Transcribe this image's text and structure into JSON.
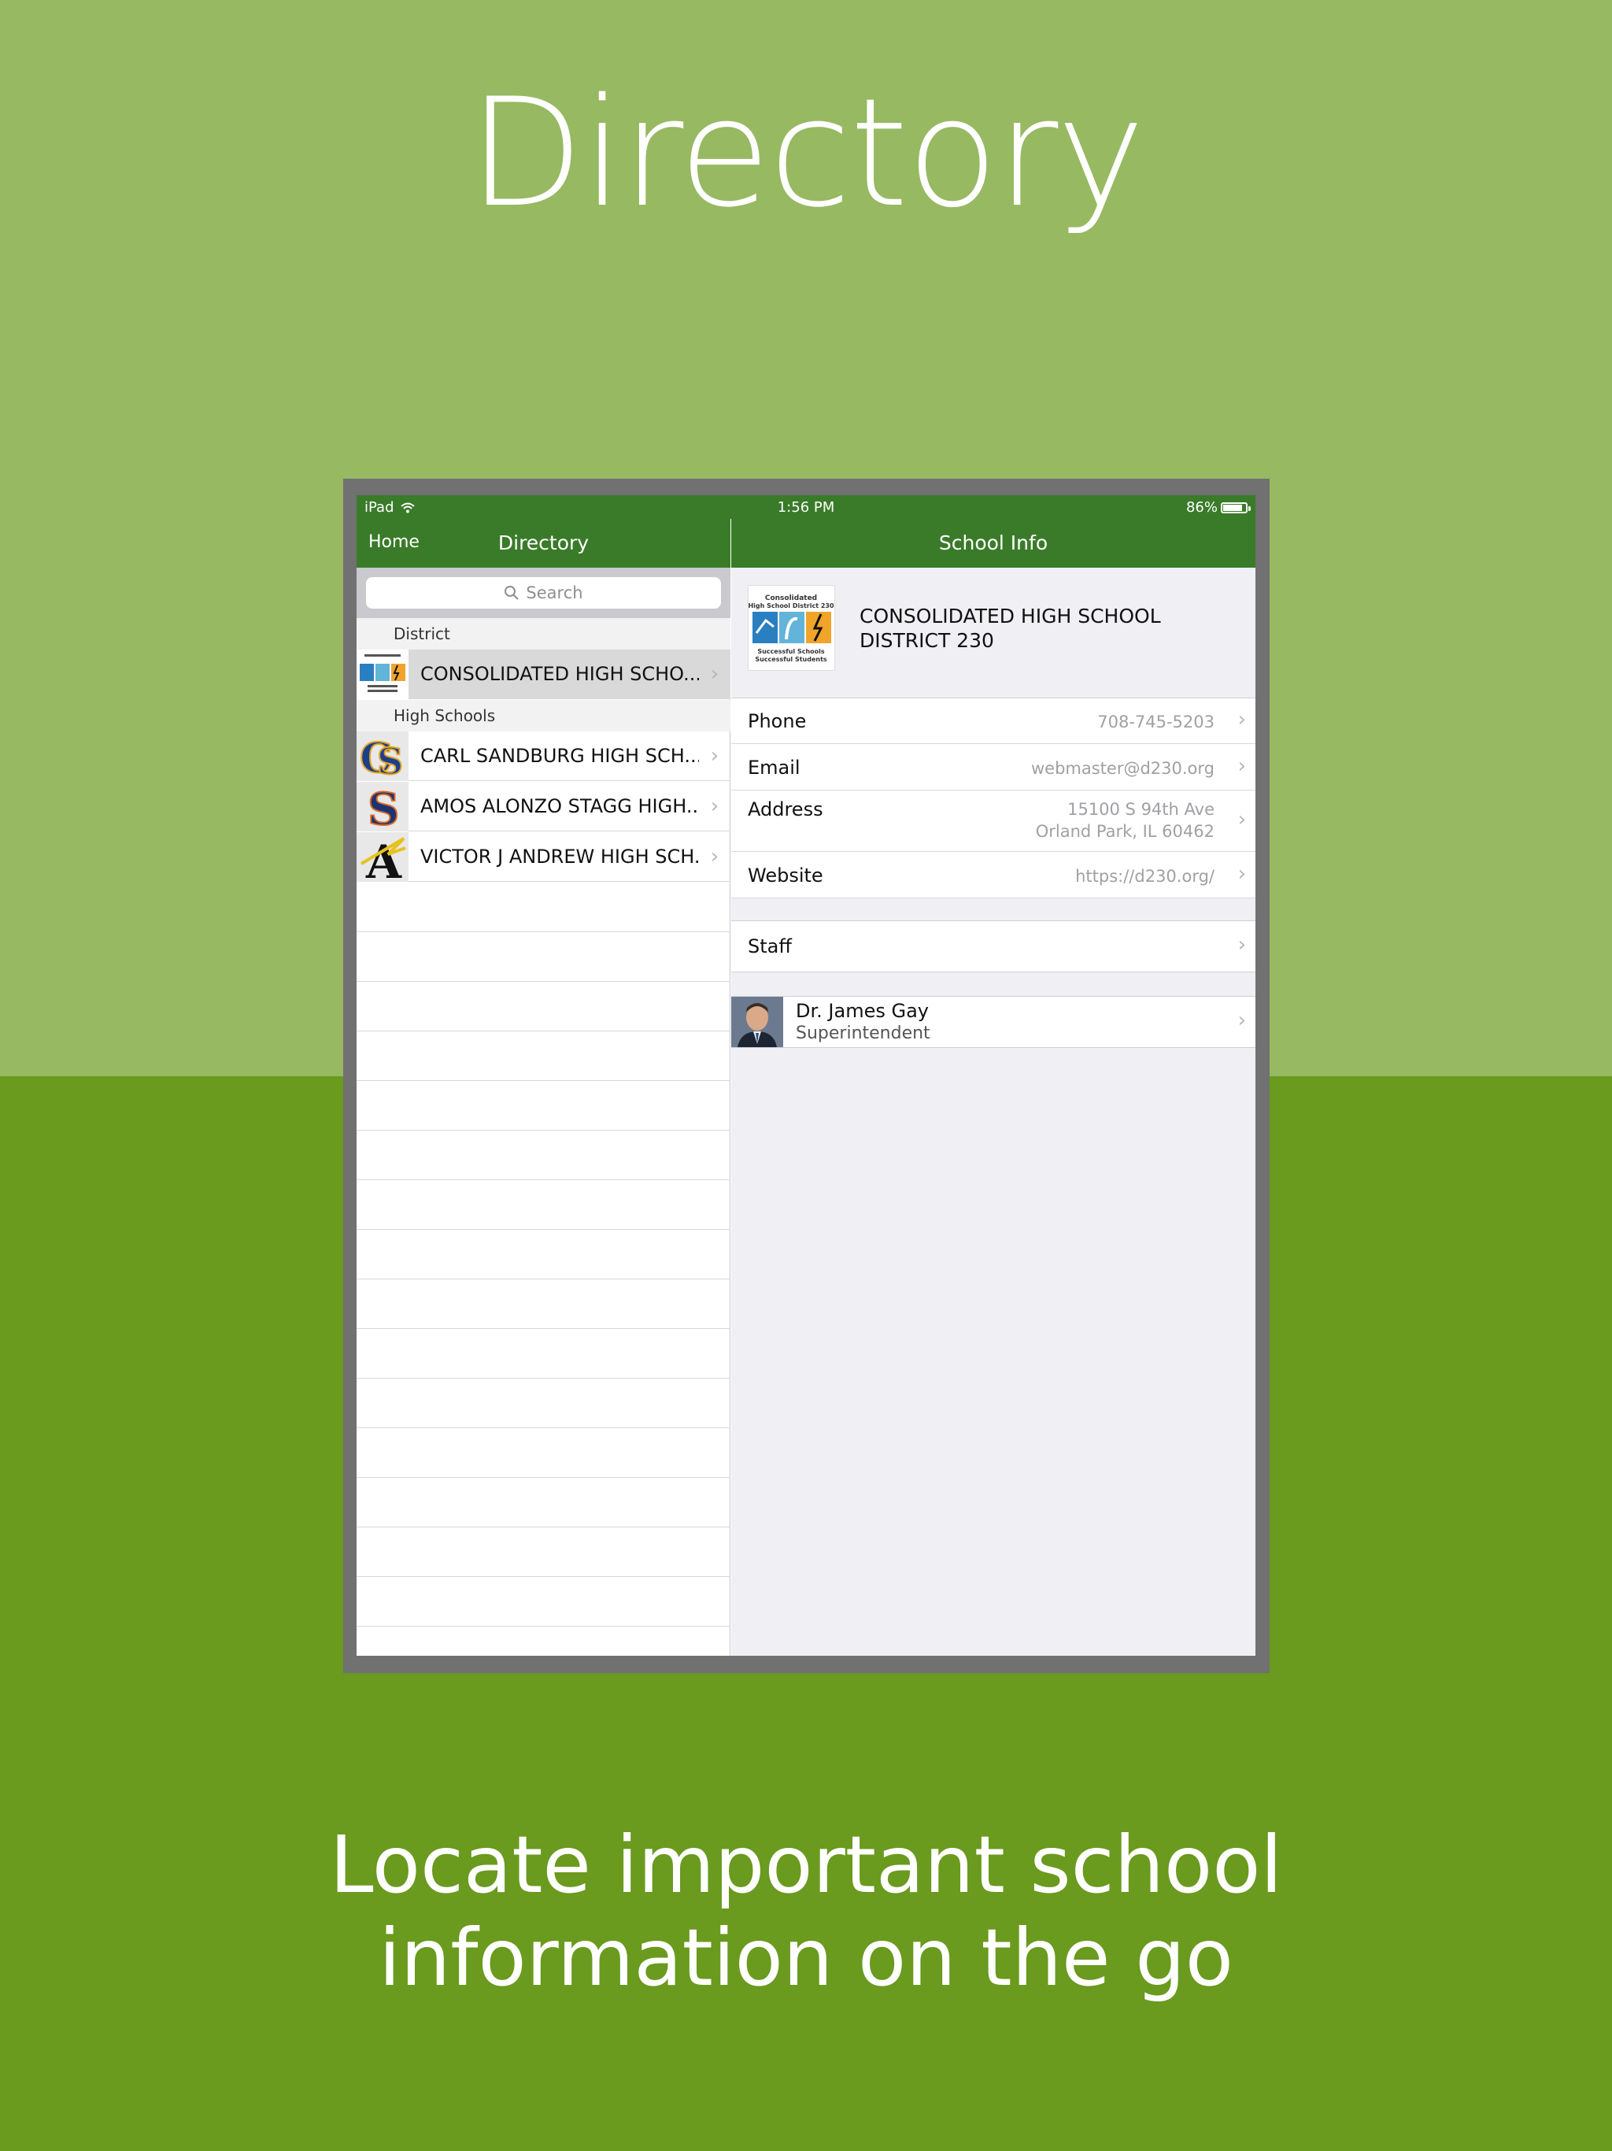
{
  "promo": {
    "title": "Directory",
    "tagline_line1": "Locate important school",
    "tagline_line2": "information on the go"
  },
  "status_bar": {
    "device": "iPad",
    "time": "1:56 PM",
    "battery": "86%",
    "battery_level": 0.86
  },
  "master": {
    "back_label": "Home",
    "title": "Directory",
    "search_placeholder": "Search",
    "sections": [
      {
        "header": "District",
        "items": [
          {
            "label": "CONSOLIDATED HIGH SCHO...",
            "icon": "district-logo",
            "selected": true
          }
        ]
      },
      {
        "header": "High Schools",
        "items": [
          {
            "label": "CARL SANDBURG HIGH SCH...",
            "icon": "cs-logo"
          },
          {
            "label": "AMOS ALONZO STAGG HIGH...",
            "icon": "s-logo"
          },
          {
            "label": "VICTOR J ANDREW HIGH SCH...",
            "icon": "a-logo"
          }
        ]
      }
    ]
  },
  "detail": {
    "title": "School Info",
    "school_name_line1": "CONSOLIDATED HIGH SCHOOL",
    "school_name_line2": "DISTRICT 230",
    "logo_text_top": "Consolidated",
    "logo_text_top2": "High School District 230",
    "logo_text_bottom": "Successful Schools",
    "logo_text_bottom2": "Successful Students",
    "phone_label": "Phone",
    "phone_value": "708-745-5203",
    "email_label": "Email",
    "email_value": "webmaster@d230.org",
    "address_label": "Address",
    "address_line1": "15100 S 94th Ave",
    "address_line2": "Orland Park, IL  60462",
    "website_label": "Website",
    "website_value": "https://d230.org/",
    "staff_label": "Staff",
    "contact_name": "Dr. James Gay",
    "contact_role": "Superintendent"
  },
  "colors": {
    "nav_green": "#3a7b29",
    "bg_light_green": "#97b962",
    "bg_dark_green": "#6a9a1e"
  }
}
